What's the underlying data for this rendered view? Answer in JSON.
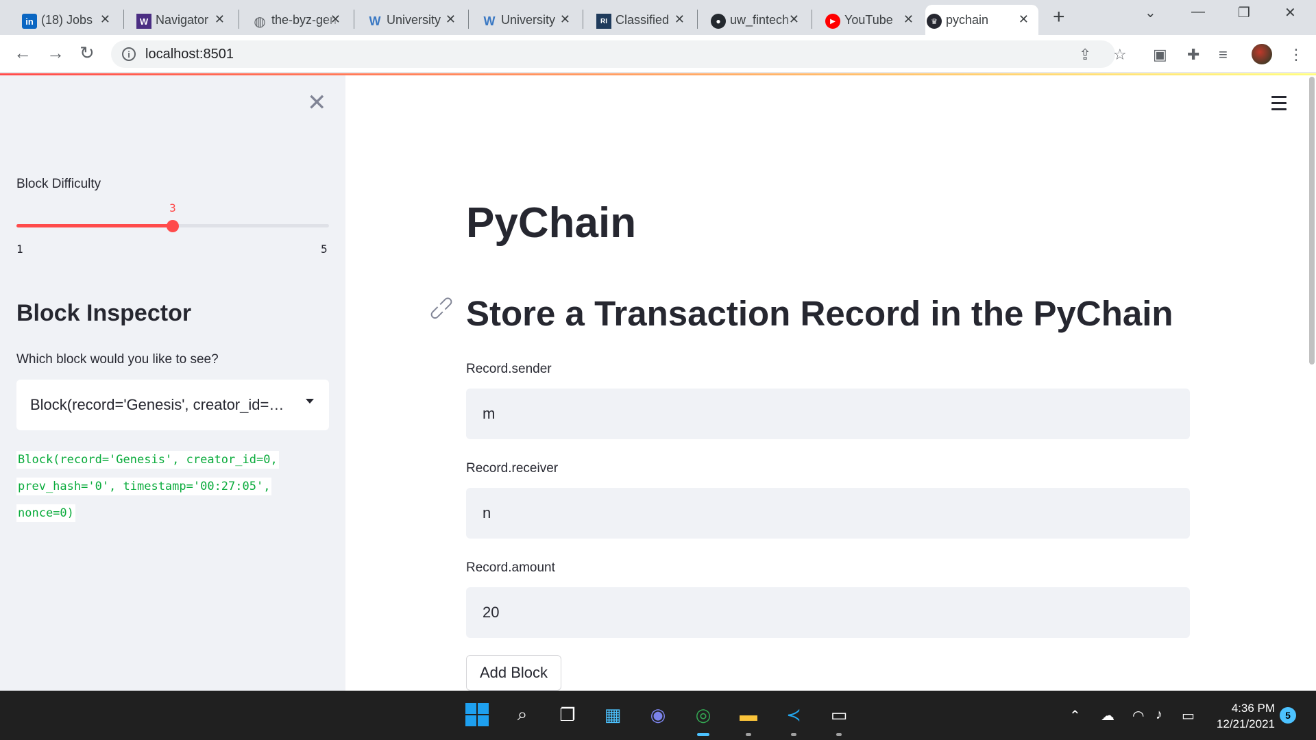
{
  "browser": {
    "tabs": [
      {
        "title": "(18) Jobs",
        "icon": "linkedin-icon"
      },
      {
        "title": "Navigator",
        "icon": "uw-w-icon"
      },
      {
        "title": "the-byz-gen",
        "icon": "globe-icon"
      },
      {
        "title": "University",
        "icon": "w-icon"
      },
      {
        "title": "University",
        "icon": "w-icon"
      },
      {
        "title": "Classified",
        "icon": "classified-icon"
      },
      {
        "title": "uw_fintech",
        "icon": "github-icon"
      },
      {
        "title": "YouTube",
        "icon": "youtube-icon"
      },
      {
        "title": "pychain",
        "icon": "streamlit-icon"
      }
    ],
    "active_tab_index": 8,
    "url": "localhost:8501"
  },
  "sidebar": {
    "slider": {
      "label": "Block Difficulty",
      "value": "3",
      "min": "1",
      "max": "5",
      "fraction": 0.5,
      "accent": "#ff4b4b"
    },
    "inspector_title": "Block Inspector",
    "select_label": "Which block would you like to see?",
    "select_value": "Block(record='Genesis', creator_id=0, prev_hash='0', timestamp='00:27:05', nonce=0)",
    "code_lines": [
      "Block(record='Genesis', creator_id=0,",
      "prev_hash='0', timestamp='00:27:05',",
      "nonce=0)"
    ]
  },
  "main": {
    "title": "PyChain",
    "subtitle": "Store a Transaction Record in the PyChain",
    "fields": [
      {
        "label": "Record.sender",
        "value": "m"
      },
      {
        "label": "Record.receiver",
        "value": "n"
      },
      {
        "label": "Record.amount",
        "value": "20"
      }
    ],
    "button_label": "Add Block"
  },
  "taskbar": {
    "time": "4:36 PM",
    "date": "12/21/2021",
    "notifications": "5"
  }
}
